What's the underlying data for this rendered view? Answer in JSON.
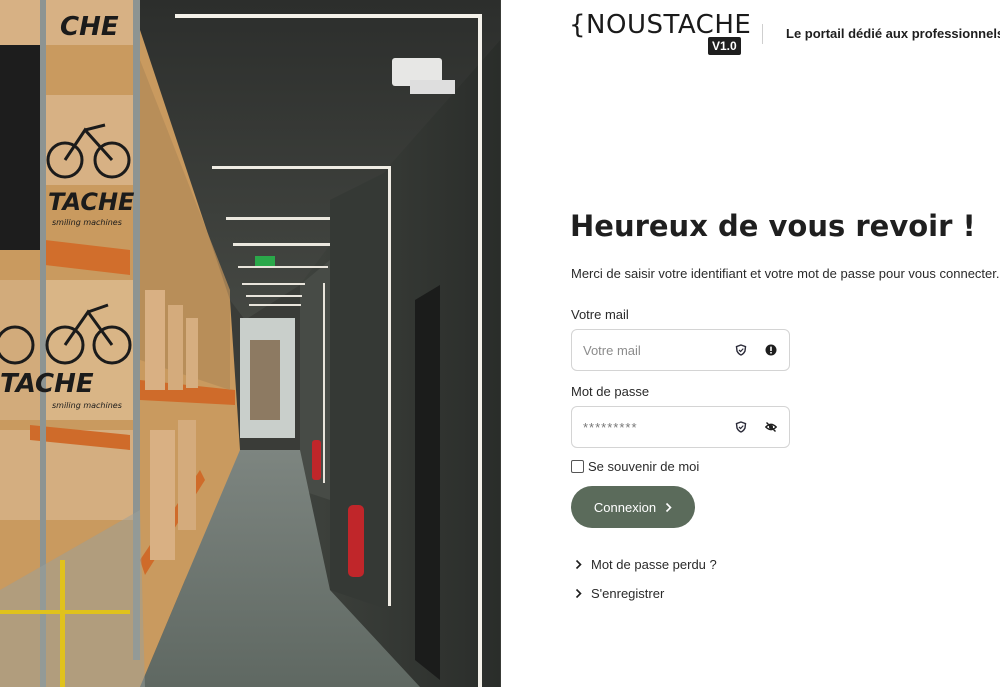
{
  "brand": {
    "logo_text": "{NOUSTACHE",
    "version": "V1.0",
    "tagline": "Le portail dédié aux professionnels"
  },
  "login": {
    "title": "Heureux de vous revoir !",
    "subtitle": "Merci de saisir votre identifiant et votre mot de passe pour vous connecter.",
    "email_label": "Votre mail",
    "email_placeholder": "Votre mail",
    "password_label": "Mot de passe",
    "password_value": "*********",
    "remember_label": "Se souvenir de moi",
    "submit_label": "Connexion",
    "forgot_label": "Mot de passe perdu ?",
    "register_label": "S'enregistrer"
  },
  "photo": {
    "box_labels": [
      "CHE",
      "TACHE",
      "TACHE",
      "smiling machines",
      "smiling machines"
    ],
    "exit_sign": "exit-sign-icon"
  },
  "colors": {
    "button": "#5b6b5b",
    "text": "#1f1f1f",
    "input_border": "#d4d4d4",
    "badge": "#1e1e1e"
  },
  "icons": {
    "shield": "shield-icon",
    "alert": "alert-icon",
    "eye_off": "eye-off-icon",
    "chevron": "chevron-right-icon"
  }
}
